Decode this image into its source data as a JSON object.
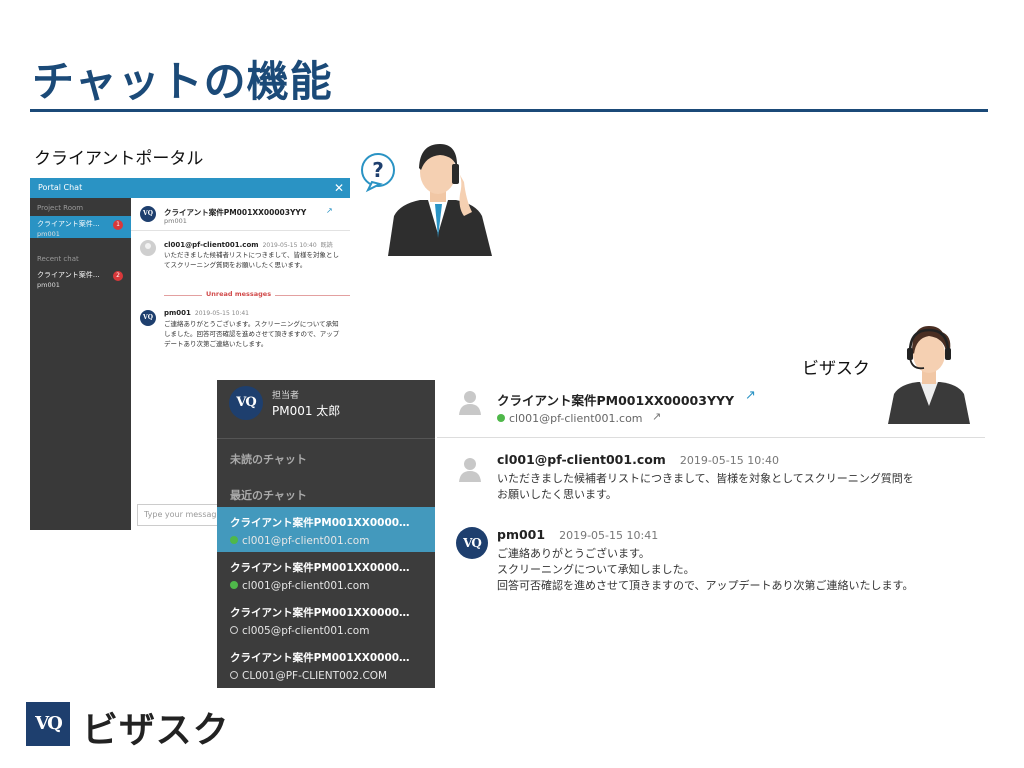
{
  "slide": {
    "title": "チャットの機能",
    "portal_heading": "クライアントポータル",
    "vq_heading": "ビザスク"
  },
  "portal": {
    "header_title": "Portal Chat",
    "close_glyph": "✕",
    "section_project": "Project Room",
    "section_recent": "Recent chat",
    "items": [
      {
        "title": "クライアント案件…",
        "sub": "pm001",
        "badge": "1"
      },
      {
        "title": "クライアント案件…",
        "sub": "pm001",
        "badge": "2"
      }
    ],
    "conversation": {
      "avatar": "VQ",
      "title": "クライアント案件PM001XX00003YYY",
      "sub": "pm001",
      "ext_glyph": "↗"
    },
    "messages": [
      {
        "sender": "cl001@pf-client001.com",
        "time": "2019-05-15 10:40",
        "status": "既読",
        "body": "いただきました候補者リストにつきまして、皆様を対象としてスクリーニング質問をお願いしたく思います。"
      },
      {
        "sender": "pm001",
        "time": "2019-05-15 10:41",
        "avatar": "VQ",
        "body": "ご連絡ありがとうございます。スクリーニングについて承知しました。回答可否確認を進めさせて頂きますので、アップデートあり次第ご連絡いたします。"
      }
    ],
    "unread_label": "Unread messages",
    "input_placeholder": "Type your message"
  },
  "vq": {
    "logo": "VQ",
    "role_label": "担当者",
    "user_name": "PM001 太郎",
    "section_unread": "未読のチャット",
    "section_recent": "最近のチャット",
    "items": [
      {
        "title": "クライアント案件PM001XX0000…",
        "sub": "cl001@pf-client001.com",
        "online": true
      },
      {
        "title": "クライアント案件PM001XX0000…",
        "sub": "cl001@pf-client001.com",
        "online": true
      },
      {
        "title": "クライアント案件PM001XX0000…",
        "sub": "cl005@pf-client001.com",
        "online": false
      },
      {
        "title": "クライアント案件PM001XX0000…",
        "sub": "CL001@PF-CLIENT002.COM",
        "online": false
      }
    ],
    "conversation": {
      "title": "クライアント案件PM001XX00003YYY",
      "sub": "cl001@pf-client001.com",
      "ext_glyph": "↗"
    },
    "messages": [
      {
        "sender": "cl001@pf-client001.com",
        "time": "2019-05-15 10:40",
        "body_lines": [
          "いただきました候補者リストにつきまして、皆様を対象としてスクリーニング質問を",
          "お願いしたく思います。"
        ]
      },
      {
        "sender": "pm001",
        "time": "2019-05-15 10:41",
        "avatar": "VQ",
        "body_lines": [
          "ご連絡ありがとうございます。",
          "スクリーニングについて承知しました。",
          "回答可否確認を進めさせて頂きますので、アップデートあり次第ご連絡いたします。"
        ]
      }
    ]
  },
  "footer": {
    "logo": "VQ",
    "brand": "ビザスク"
  },
  "colors": {
    "navy": "#1b4a78",
    "accent_blue": "#2a93c4",
    "online_green": "#4fb84a",
    "unread_red": "#d9383a"
  }
}
